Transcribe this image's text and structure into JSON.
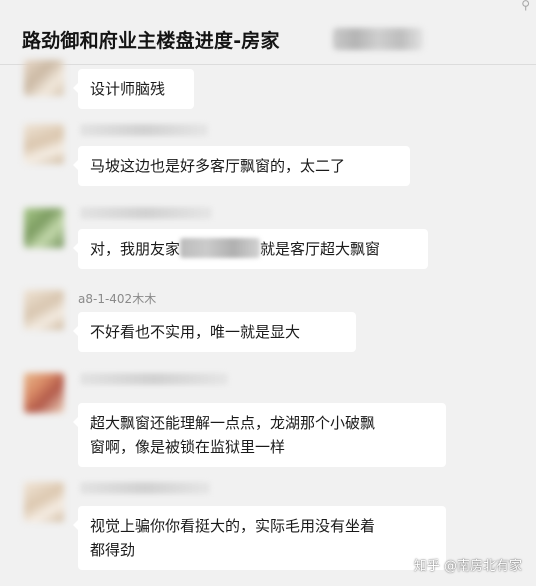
{
  "header": {
    "title": "路劲御和府业主楼盘进度-房家",
    "pin_icon": "pin-icon"
  },
  "messages": [
    {
      "id": 1,
      "sender": "",
      "text": "设计师脑残"
    },
    {
      "id": 2,
      "sender": "",
      "text": "马坡这边也是好多客厅飘窗的，太二了"
    },
    {
      "id": 3,
      "sender": "",
      "text_before": "对，我朋友家",
      "text_after": "就是客厅超大飘窗"
    },
    {
      "id": 4,
      "sender": "a8-1-402木木",
      "text": "不好看也不实用，唯一就是显大"
    },
    {
      "id": 5,
      "sender": "",
      "text_line1": "超大飘窗还能理解一点点，龙湖那个小破飘",
      "text_line2": "窗啊，像是被锁在监狱里一样"
    },
    {
      "id": 6,
      "sender": "",
      "text_line1": "视觉上骗你你看挺大的，实际毛用没有坐着",
      "text_line2": "都得劲"
    }
  ],
  "watermark": "知乎 @南房北有家",
  "colors": {
    "background": "#f1f1f1",
    "bubble": "#ffffff",
    "text": "#1a1a1a",
    "sender": "#8a8a8a"
  }
}
